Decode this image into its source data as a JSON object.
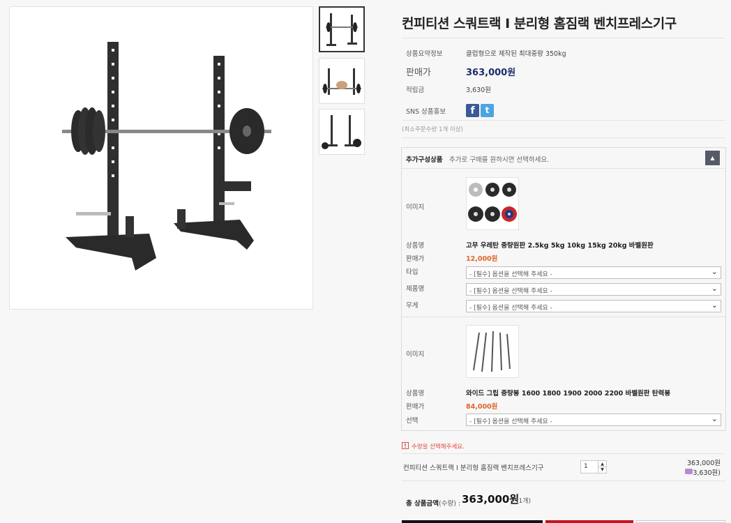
{
  "product": {
    "title": "컨피티션 스쿼트랙 I 분리형 홈짐랙 벤치프레스기구",
    "summary_label": "상품요약정보",
    "summary_value": "클럽형으로 제작된 최대중량 350kg",
    "price_label": "판매가",
    "price_value": "363,000원",
    "points_label": "적립금",
    "points_value": "3,630원",
    "sns_label": "SNS 상품홍보",
    "min_order_note": "(최소주문수량 1개 이상)"
  },
  "addon": {
    "header_label": "추가구성상품",
    "header_hint": "추가로 구매를 원하시면 선택하세요.",
    "items": [
      {
        "image_label": "이미지",
        "name_label": "상품명",
        "name": "고무 우레탄 중량원판 2.5kg 5kg 10kg 15kg 20kg 바벨원판",
        "price_label": "판매가",
        "price": "12,000원",
        "options": [
          {
            "label": "타입",
            "placeholder": "- [필수] 옵션을 선택해 주세요 -"
          },
          {
            "label": "제품명",
            "placeholder": "- [필수] 옵션을 선택해 주세요 -"
          },
          {
            "label": "무게",
            "placeholder": "- [필수] 옵션을 선택해 주세요 -"
          }
        ]
      },
      {
        "image_label": "이미지",
        "name_label": "상품명",
        "name": "와이드 그립 중량봉 1600 1800 1900 2000 2200 바벨원판 탄력봉",
        "price_label": "판매가",
        "price": "84,000원",
        "options": [
          {
            "label": "선택",
            "placeholder": "- [필수] 옵션을 선택해 주세요 -"
          }
        ]
      }
    ]
  },
  "alert": "수량을 선택해주세요.",
  "cart_row": {
    "name": "컨피티션 스쿼트랙 I 분리형 홈짐랙 벤치프레스기구",
    "quantity": "1",
    "price": "363,000원",
    "points": "3,630원)"
  },
  "total": {
    "label": "총 상품금액",
    "qty_label": "(수량) :",
    "amount": "363,000원",
    "count": "(1개)"
  },
  "colors": {
    "price_blue": "#1a2d6b",
    "option_price": "#e0652a",
    "alert_red": "#e04a3a",
    "facebook": "#3b5998",
    "twitter": "#4aa5e0"
  }
}
